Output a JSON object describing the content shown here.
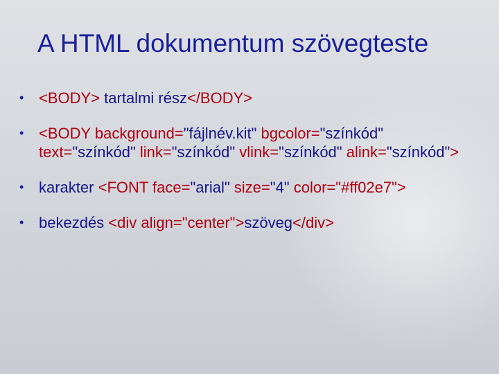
{
  "title": "A HTML dokumentum szövegteste",
  "colors": {
    "title": "#1a1f9c",
    "tag": "#b00012",
    "text": "#15158a"
  },
  "bullets": [
    {
      "segments": [
        {
          "t": "<BODY>",
          "c": "r"
        },
        {
          "t": " tartalmi rész",
          "c": "b"
        },
        {
          "t": "</BODY>",
          "c": "r"
        }
      ]
    },
    {
      "segments": [
        {
          "t": "<BODY background=",
          "c": "r"
        },
        {
          "t": "\"fájlnév.kit\"",
          "c": "b"
        },
        {
          "t": " bgcolor=",
          "c": "r"
        },
        {
          "t": "\"színkód\"",
          "c": "b"
        },
        {
          "t": " text=",
          "c": "r"
        },
        {
          "t": "\"színkód\"",
          "c": "b"
        },
        {
          "t": " link=",
          "c": "r"
        },
        {
          "t": "\"színkód\"",
          "c": "b"
        },
        {
          "t": " vlink=",
          "c": "r"
        },
        {
          "t": "\"színkód\"",
          "c": "b"
        },
        {
          "t": " alink=",
          "c": "r"
        },
        {
          "t": "\"színkód\"",
          "c": "b"
        },
        {
          "t": ">",
          "c": "r"
        }
      ]
    },
    {
      "segments": [
        {
          "t": "karakter  ",
          "c": "b"
        },
        {
          "t": "<FONT face=",
          "c": "r"
        },
        {
          "t": "\"arial\"",
          "c": "b"
        },
        {
          "t": " size=",
          "c": "r"
        },
        {
          "t": "\"4\"",
          "c": "b"
        },
        {
          "t": " color=\"#ff02e7\">",
          "c": "r"
        }
      ]
    },
    {
      "segments": [
        {
          "t": "bekezdés ",
          "c": "b"
        },
        {
          "t": "<div align=\"center\">",
          "c": "r"
        },
        {
          "t": "szöveg",
          "c": "b"
        },
        {
          "t": "</div>",
          "c": "r"
        }
      ]
    }
  ]
}
